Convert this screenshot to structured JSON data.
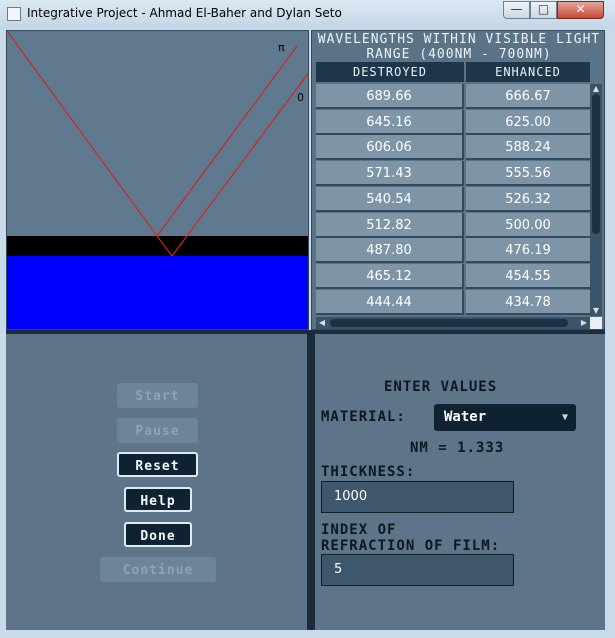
{
  "window": {
    "title": "Integrative Project - Ahmad El-Baher and Dylan Seto",
    "minimize_label": "—",
    "maximize_label": "□",
    "close_label": "✕"
  },
  "simulation": {
    "phase_label_top": "π",
    "phase_label_mid": "0",
    "colors": {
      "background": "#5f7a8e",
      "film": "#000000",
      "medium": "#0000ff",
      "ray": "#d22222"
    }
  },
  "table": {
    "heading": "Wavelengths within visible light range (400nm - 700nm)",
    "columns": [
      "Destroyed",
      "Enhanced"
    ],
    "rows": [
      [
        "689.66",
        "666.67"
      ],
      [
        "645.16",
        "625.00"
      ],
      [
        "606.06",
        "588.24"
      ],
      [
        "571.43",
        "555.56"
      ],
      [
        "540.54",
        "526.32"
      ],
      [
        "512.82",
        "500.00"
      ],
      [
        "487.80",
        "476.19"
      ],
      [
        "465.12",
        "454.55"
      ],
      [
        "444.44",
        "434.78"
      ]
    ]
  },
  "controls": {
    "start": "Start",
    "pause": "Pause",
    "reset": "Reset",
    "help": "Help",
    "done": "Done",
    "continue": "Continue"
  },
  "form": {
    "heading": "Enter Values",
    "material_label": "Material:",
    "material_value": "Water",
    "nm_text": "NM = 1.333",
    "thickness_label": "Thickness:",
    "thickness_value": "1000",
    "index_label_line1": "Index of",
    "index_label_line2": "Refraction of Film:",
    "index_value": "5"
  }
}
